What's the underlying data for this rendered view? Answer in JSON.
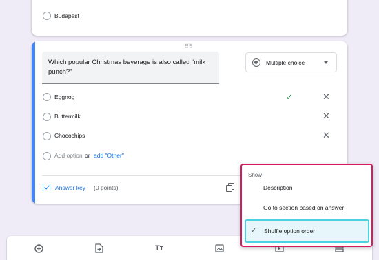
{
  "previous_question": {
    "options": [
      "Budapest"
    ]
  },
  "question": {
    "title": "Which popular Christmas beverage is also called “milk punch?”",
    "type_label": "Multiple choice",
    "options": [
      "Eggnog",
      "Buttermilk",
      "Chocochips"
    ],
    "correct_option_index": 0,
    "add_option_label": "Add option",
    "or_label": "or",
    "add_other_label": "add \"Other\"",
    "answer_key_label": "Answer key",
    "points_label": "(0 points)"
  },
  "menu": {
    "header": "Show",
    "items": [
      "Description",
      "Go to section based on answer",
      "Shuffle option order"
    ],
    "checked_item": "Shuffle option order"
  },
  "icons": {
    "check": "check-icon",
    "remove": "close-icon",
    "copy": "copy-icon",
    "answer_key": "answer-key-checkbox-icon",
    "toolbar": [
      "add-question-icon",
      "import-questions-icon",
      "add-title-icon",
      "add-image-icon",
      "add-video-icon",
      "add-section-icon"
    ]
  },
  "colors": {
    "accent": "#4285f4",
    "link": "#1a73e8",
    "correct": "#188038",
    "highlight_border_menu": "#d81b60",
    "highlight_border_item": "#4dd0e1"
  }
}
